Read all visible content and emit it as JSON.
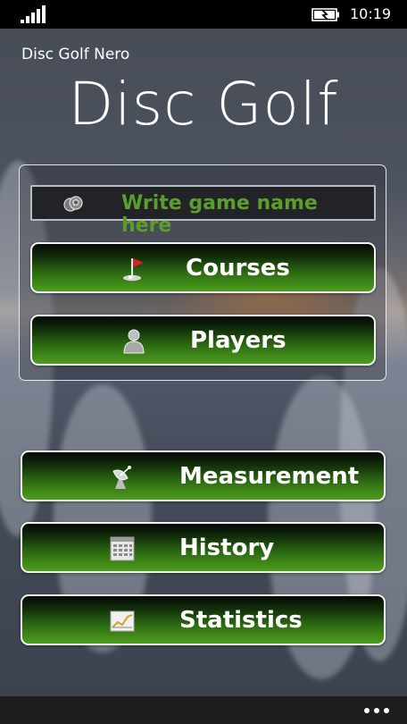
{
  "status_bar": {
    "time": "10:19",
    "signal_icon": "signal-bars-icon",
    "battery_icon": "battery-charging-icon"
  },
  "header": {
    "app_title": "Disc Golf Nero",
    "page_title": "Disc Golf"
  },
  "game_panel": {
    "name_placeholder": "Write game name here",
    "name_icon": "discs-icon",
    "placeholder_color": "#5b9e2e",
    "courses": {
      "label": "Courses",
      "icon": "golf-flag-icon"
    },
    "players": {
      "label": "Players",
      "icon": "player-icon"
    }
  },
  "menu": {
    "measurement": {
      "label": "Measurement",
      "icon": "satellite-dish-icon"
    },
    "history": {
      "label": "History",
      "icon": "calendar-icon"
    },
    "statistics": {
      "label": "Statistics",
      "icon": "line-chart-icon"
    }
  },
  "app_bar": {
    "more_icon": "more-dots-icon"
  },
  "colors": {
    "button_green": "#4e9e1e",
    "button_dark": "#050805",
    "button_border": "#f2f2f2"
  }
}
